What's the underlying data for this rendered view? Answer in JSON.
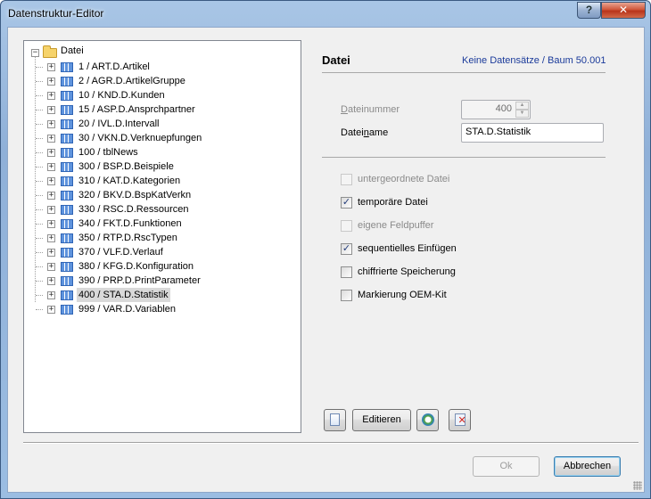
{
  "window": {
    "title": "Datenstruktur-Editor",
    "help_label": "?",
    "close_label": "✕"
  },
  "tree": {
    "root": {
      "label": "Datei",
      "icon": "folder-icon"
    },
    "items": [
      {
        "number": "1",
        "label": "1 / ART.D.Artikel",
        "selected": false
      },
      {
        "number": "2",
        "label": "2 / AGR.D.ArtikelGruppe",
        "selected": false
      },
      {
        "number": "10",
        "label": "10 / KND.D.Kunden",
        "selected": false
      },
      {
        "number": "15",
        "label": "15 / ASP.D.Ansprchpartner",
        "selected": false
      },
      {
        "number": "20",
        "label": "20 / IVL.D.Intervall",
        "selected": false
      },
      {
        "number": "30",
        "label": "30 / VKN.D.Verknuepfungen",
        "selected": false
      },
      {
        "number": "100",
        "label": "100 / tblNews",
        "selected": false
      },
      {
        "number": "300",
        "label": "300 / BSP.D.Beispiele",
        "selected": false
      },
      {
        "number": "310",
        "label": "310 / KAT.D.Kategorien",
        "selected": false
      },
      {
        "number": "320",
        "label": "320 / BKV.D.BspKatVerkn",
        "selected": false
      },
      {
        "number": "330",
        "label": "330 / RSC.D.Ressourcen",
        "selected": false
      },
      {
        "number": "340",
        "label": "340 / FKT.D.Funktionen",
        "selected": false
      },
      {
        "number": "350",
        "label": "350 / RTP.D.RscTypen",
        "selected": false
      },
      {
        "number": "370",
        "label": "370 / VLF.D.Verlauf",
        "selected": false
      },
      {
        "number": "380",
        "label": "380 / KFG.D.Konfiguration",
        "selected": false
      },
      {
        "number": "390",
        "label": "390 / PRP.D.PrintParameter",
        "selected": false
      },
      {
        "number": "400",
        "label": "400 / STA.D.Statistik",
        "selected": true
      },
      {
        "number": "999",
        "label": "999 / VAR.D.Variablen",
        "selected": false
      }
    ]
  },
  "details": {
    "title": "Datei",
    "status": "Keine Datensätze / Baum 50.001",
    "dateinummer": {
      "label": "Dateinummer",
      "value": "400"
    },
    "dateiname": {
      "label": "Dateiname",
      "value": "STA.D.Statistik"
    },
    "options": [
      {
        "label": "untergeordnete Datei",
        "checked": false,
        "enabled": false
      },
      {
        "label": "temporäre Datei",
        "checked": true,
        "enabled": true
      },
      {
        "label": "eigene Feldpuffer",
        "checked": false,
        "enabled": false
      },
      {
        "label": "sequentielles Einfügen",
        "checked": true,
        "enabled": true
      },
      {
        "label": "chiffrierte Speicherung",
        "checked": false,
        "enabled": true
      },
      {
        "label": "Markierung OEM-Kit",
        "checked": false,
        "enabled": true
      }
    ]
  },
  "toolbar": {
    "new_icon": "new-document-icon",
    "edit_label": "Editieren",
    "refresh_icon": "refresh-icon",
    "delete_icon": "delete-document-icon"
  },
  "dialog": {
    "ok_label": "Ok",
    "cancel_label": "Abbrechen"
  }
}
